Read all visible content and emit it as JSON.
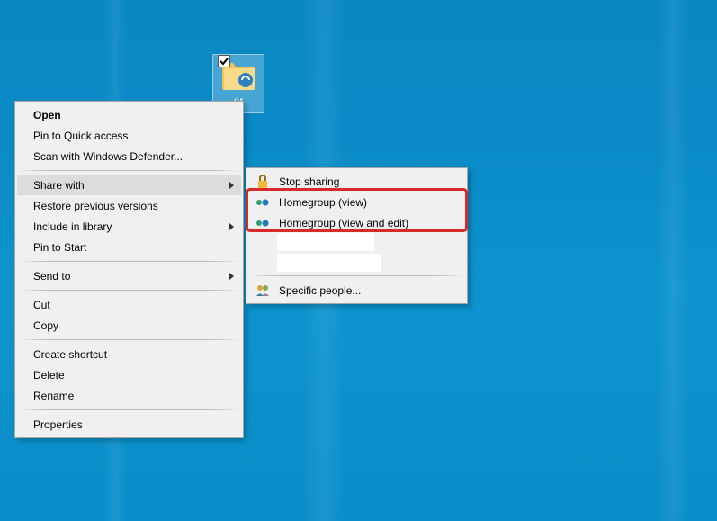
{
  "desktop": {
    "icon_label": "er"
  },
  "context_menu": {
    "open": "Open",
    "pin_quick_access": "Pin to Quick access",
    "scan_defender": "Scan with Windows Defender...",
    "share_with": "Share with",
    "restore_previous": "Restore previous versions",
    "include_library": "Include in library",
    "pin_start": "Pin to Start",
    "send_to": "Send to",
    "cut": "Cut",
    "copy": "Copy",
    "create_shortcut": "Create shortcut",
    "delete": "Delete",
    "rename": "Rename",
    "properties": "Properties"
  },
  "share_submenu": {
    "stop_sharing": "Stop sharing",
    "homegroup_view": "Homegroup (view)",
    "homegroup_view_edit": "Homegroup (view and edit)",
    "specific_people": "Specific people..."
  },
  "highlight": {
    "target": "share_with",
    "red_box_items": [
      "homegroup_view",
      "homegroup_view_edit"
    ]
  }
}
